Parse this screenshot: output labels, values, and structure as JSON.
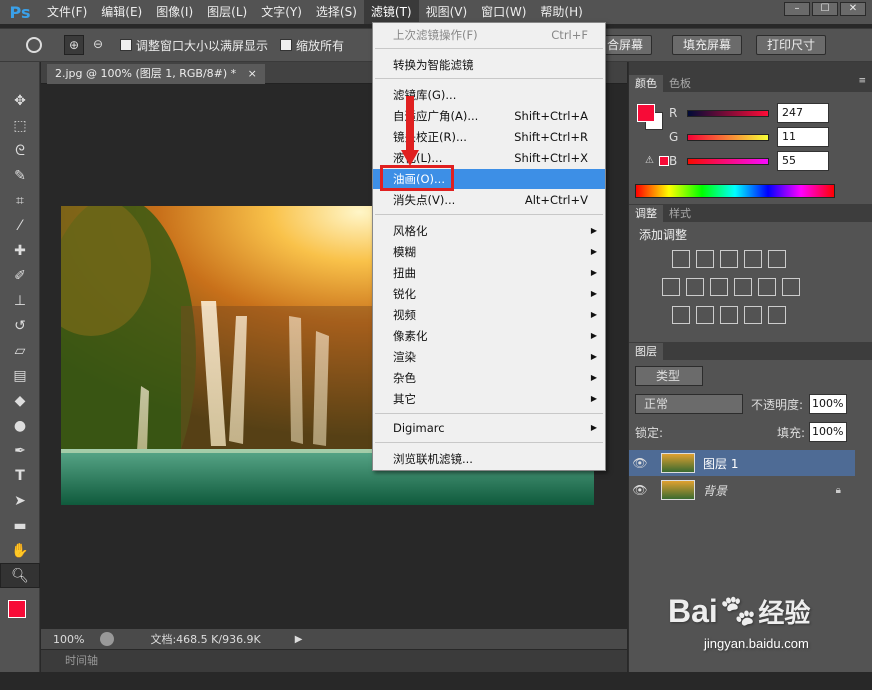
{
  "app": {
    "logo": "Ps"
  },
  "menubar": {
    "items": [
      "文件(F)",
      "编辑(E)",
      "图像(I)",
      "图层(L)",
      "文字(Y)",
      "选择(S)",
      "滤镜(T)",
      "视图(V)",
      "窗口(W)",
      "帮助(H)"
    ],
    "active_index": 6,
    "window_controls": [
      "–",
      "☐",
      "✕"
    ]
  },
  "options_bar": {
    "checkbox1": "调整窗口大小以满屏显示",
    "checkbox2": "缩放所有",
    "btn_fit": "合屏幕",
    "btn_fill": "填充屏幕",
    "btn_print": "打印尺寸"
  },
  "document": {
    "tab_title": "2.jpg @ 100% (图层 1, RGB/8#) *",
    "close": "×"
  },
  "filter_menu": {
    "items": [
      {
        "label": "上次滤镜操作(F)",
        "shortcut": "Ctrl+F",
        "disabled": true
      },
      {
        "label": "转换为智能滤镜",
        "shortcut": ""
      },
      {
        "label": "滤镜库(G)...",
        "shortcut": ""
      },
      {
        "label": "自适应广角(A)...",
        "shortcut": "Shift+Ctrl+A"
      },
      {
        "label": "镜头校正(R)...",
        "shortcut": "Shift+Ctrl+R"
      },
      {
        "label": "液化(L)...",
        "shortcut": "Shift+Ctrl+X"
      },
      {
        "label": "油画(O)...",
        "shortcut": "",
        "highlighted": true
      },
      {
        "label": "消失点(V)...",
        "shortcut": "Alt+Ctrl+V"
      },
      {
        "label": "风格化",
        "submenu": true
      },
      {
        "label": "模糊",
        "submenu": true
      },
      {
        "label": "扭曲",
        "submenu": true
      },
      {
        "label": "锐化",
        "submenu": true
      },
      {
        "label": "视频",
        "submenu": true
      },
      {
        "label": "像素化",
        "submenu": true
      },
      {
        "label": "渲染",
        "submenu": true
      },
      {
        "label": "杂色",
        "submenu": true
      },
      {
        "label": "其它",
        "submenu": true
      },
      {
        "label": "Digimarc",
        "submenu": true
      },
      {
        "label": "浏览联机滤镜..."
      }
    ]
  },
  "status": {
    "zoom": "100%",
    "doc_info": "文档:468.5 K/936.9K"
  },
  "timeline": {
    "label": "时间轴"
  },
  "color_panel": {
    "tabs": [
      "颜色",
      "色板"
    ],
    "r_label": "R",
    "g_label": "G",
    "b_label": "B",
    "r": "247",
    "g": "11",
    "b": "55",
    "foreground": "#f70b37"
  },
  "adjust_panel": {
    "tabs": [
      "调整",
      "样式"
    ],
    "title": "添加调整"
  },
  "layers_panel": {
    "tab": "图层",
    "filter": "类型",
    "blend_mode": "正常",
    "opacity_label": "不透明度:",
    "opacity": "100%",
    "lock_label": "锁定:",
    "fill_label": "填充:",
    "fill": "100%",
    "layers": [
      {
        "name": "图层 1",
        "selected": true
      },
      {
        "name": "背景",
        "locked": true
      }
    ]
  },
  "watermark": {
    "brand": "Bai",
    "brand2": "经验",
    "url": "jingyan.baidu.com"
  }
}
